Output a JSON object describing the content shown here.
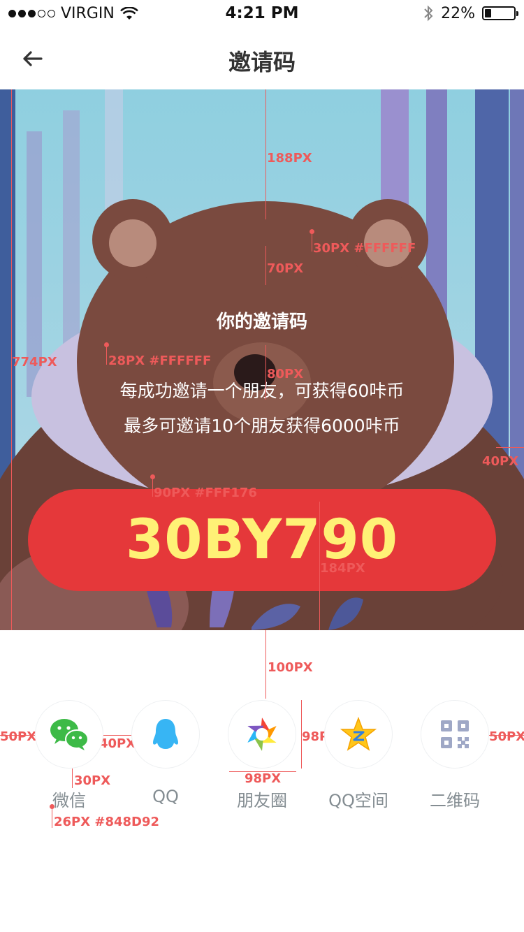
{
  "status": {
    "carrier": "VIRGIN",
    "time": "4:21 PM",
    "battery": "22%",
    "battery_level": 0.22
  },
  "nav": {
    "title": "邀请码",
    "back_icon": "back-arrow-icon"
  },
  "poster": {
    "title": "你的邀请码",
    "desc_line1": "每成功邀请一个朋友，可获得60咔币",
    "desc_line2": "最多可邀请10个朋友获得6000咔币",
    "code": "30BY790",
    "colors": {
      "pill": "#E5383A",
      "code": "#FFF176",
      "text": "#FFFFFF"
    }
  },
  "share": {
    "items": [
      {
        "label": "微信",
        "icon": "wechat-icon"
      },
      {
        "label": "QQ",
        "icon": "qq-icon"
      },
      {
        "label": "朋友圈",
        "icon": "moments-icon"
      },
      {
        "label": "QQ空间",
        "icon": "qzone-icon"
      },
      {
        "label": "二维码",
        "icon": "qrcode-icon"
      }
    ],
    "label_color": "#848D92"
  },
  "annotations": {
    "a188": "188PX",
    "a30": "30PX #FFFFFF",
    "a70": "70PX",
    "a774": "774PX",
    "a28": "28PX #FFFFFF",
    "a80": "80PX",
    "a40r": "40PX",
    "a90": "90PX #FFF176",
    "a184": "184PX",
    "a100": "100PX",
    "a50l": "50PX",
    "a40": "40PX",
    "a98v": "98PX",
    "a50r": "50PX",
    "a30b": "30PX",
    "a98h": "98PX",
    "a26": "26PX #848D92"
  }
}
